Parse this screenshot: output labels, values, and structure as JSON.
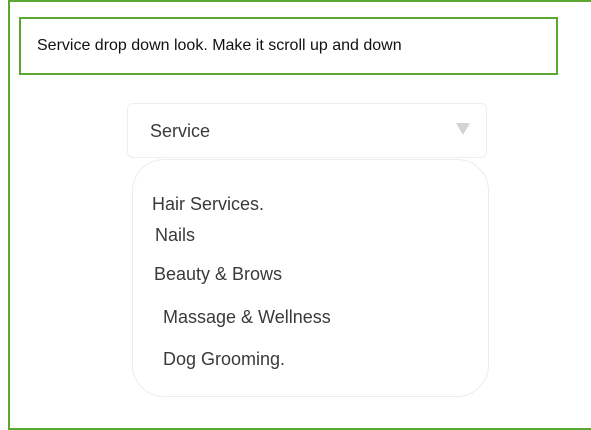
{
  "note": {
    "text": "Service drop down look. Make it scroll up and down"
  },
  "dropdown": {
    "label": "Service",
    "options": [
      "Hair Services.",
      "Nails",
      "Beauty & Brows",
      "Massage & Wellness",
      "Dog Grooming."
    ]
  },
  "colors": {
    "frame_border": "#5aa832",
    "text": "#3a3a3a",
    "caret": "#d4d4d4",
    "menu_border": "#ececec"
  }
}
